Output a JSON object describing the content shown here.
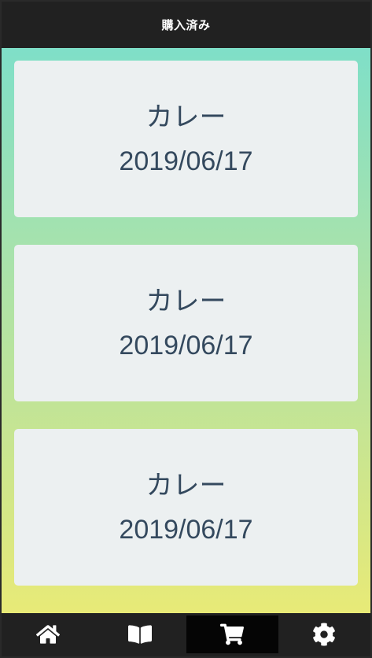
{
  "header": {
    "title": "購入済み"
  },
  "purchases": [
    {
      "name": "カレー",
      "date": "2019/06/17"
    },
    {
      "name": "カレー",
      "date": "2019/06/17"
    },
    {
      "name": "カレー",
      "date": "2019/06/17"
    }
  ],
  "tabbar": {
    "tabs": [
      {
        "icon": "home-icon"
      },
      {
        "icon": "book-icon"
      },
      {
        "icon": "cart-icon",
        "active": true
      },
      {
        "icon": "gear-icon"
      }
    ]
  }
}
